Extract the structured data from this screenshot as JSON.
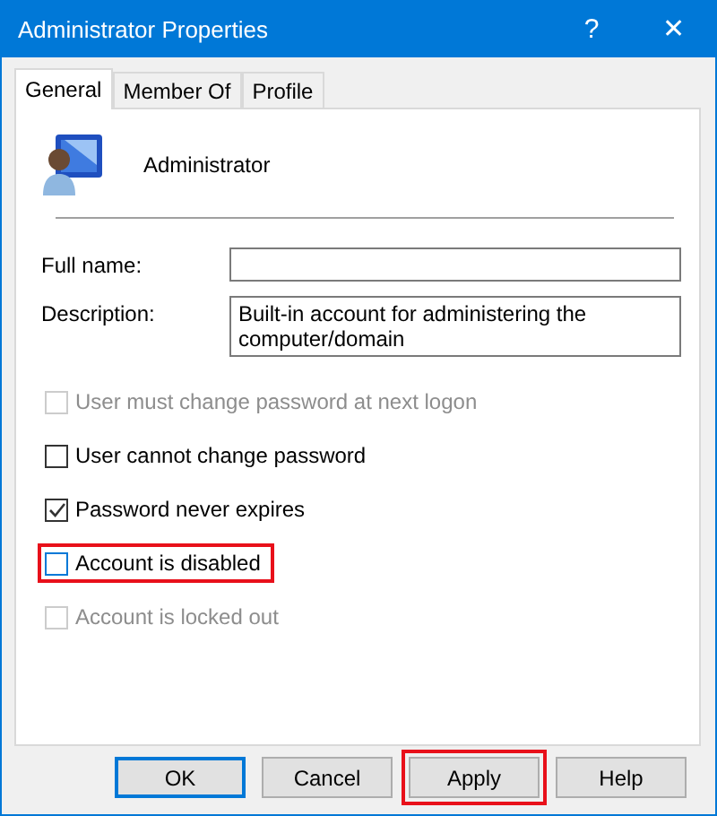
{
  "window": {
    "title": "Administrator Properties",
    "help_button": "?",
    "close_button": "✕"
  },
  "tabs": [
    {
      "label": "General",
      "selected": true
    },
    {
      "label": "Member Of",
      "selected": false
    },
    {
      "label": "Profile",
      "selected": false
    }
  ],
  "user": {
    "name": "Administrator"
  },
  "fields": [
    {
      "label": "Full name:"
    },
    {
      "label": "Description:",
      "value": "Built-in account for administering the computer/domain"
    }
  ],
  "options": [
    {
      "label": "User must change password at next logon",
      "checked": false,
      "disabled": true,
      "highlighted": false
    },
    {
      "label": "User cannot change password",
      "checked": false,
      "disabled": false,
      "highlighted": false
    },
    {
      "label": "Password never expires",
      "checked": true,
      "disabled": false,
      "highlighted": false
    },
    {
      "label": "Account is disabled",
      "checked": false,
      "disabled": false,
      "highlighted": true
    },
    {
      "label": "Account is locked out",
      "checked": false,
      "disabled": true,
      "highlighted": false
    }
  ],
  "buttons": [
    {
      "label": "OK",
      "default": true,
      "highlighted": false
    },
    {
      "label": "Cancel",
      "default": false,
      "highlighted": false
    },
    {
      "label": "Apply",
      "default": false,
      "highlighted": true
    },
    {
      "label": "Help",
      "default": false,
      "highlighted": false
    }
  ]
}
